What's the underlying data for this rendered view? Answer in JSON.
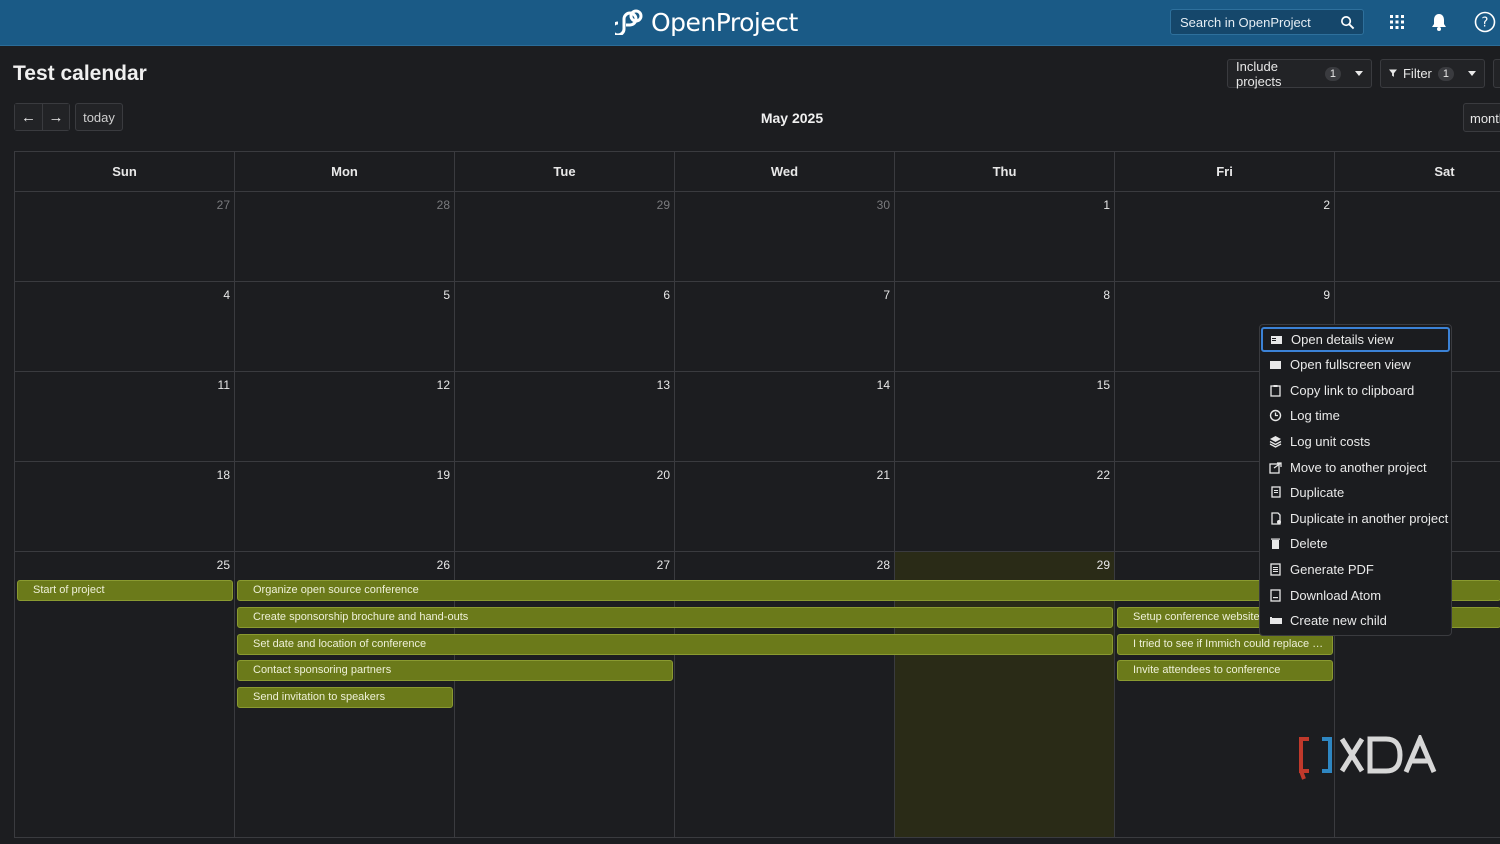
{
  "app": {
    "logo_text": "OpenProject",
    "search_placeholder": "Search in OpenProject"
  },
  "page": {
    "title": "Test calendar",
    "include_projects_label": "Include projects",
    "include_projects_count": "1",
    "filter_label": "Filter",
    "filter_count": "1"
  },
  "nav": {
    "prev_symbol": "←",
    "next_symbol": "→",
    "today_label": "today",
    "month_title": "May 2025",
    "view_label": "month"
  },
  "weekdays": [
    "Sun",
    "Mon",
    "Tue",
    "Wed",
    "Thu",
    "Fri",
    "Sat"
  ],
  "weeks": [
    [
      {
        "n": "27",
        "other": true
      },
      {
        "n": "28",
        "other": true
      },
      {
        "n": "29",
        "other": true
      },
      {
        "n": "30",
        "other": true
      },
      {
        "n": "1"
      },
      {
        "n": "2"
      },
      {
        "n": ""
      }
    ],
    [
      {
        "n": "4"
      },
      {
        "n": "5"
      },
      {
        "n": "6"
      },
      {
        "n": "7"
      },
      {
        "n": "8"
      },
      {
        "n": "9"
      },
      {
        "n": ""
      }
    ],
    [
      {
        "n": "11"
      },
      {
        "n": "12"
      },
      {
        "n": "13"
      },
      {
        "n": "14"
      },
      {
        "n": "15"
      },
      {
        "n": ""
      },
      {
        "n": ""
      }
    ],
    [
      {
        "n": "18"
      },
      {
        "n": "19"
      },
      {
        "n": "20"
      },
      {
        "n": "21"
      },
      {
        "n": "22"
      },
      {
        "n": ""
      },
      {
        "n": ""
      }
    ],
    [
      {
        "n": "25"
      },
      {
        "n": "26"
      },
      {
        "n": "27"
      },
      {
        "n": "28"
      },
      {
        "n": "29",
        "today": true
      },
      {
        "n": ""
      },
      {
        "n": ""
      }
    ]
  ],
  "events": [
    {
      "label": "Start of project",
      "start": 0,
      "end": 0,
      "row": 0
    },
    {
      "label": "Organize open source conference",
      "start": 1,
      "end": 7,
      "row": 0
    },
    {
      "label": "Create sponsorship brochure and hand-outs",
      "start": 1,
      "end": 4,
      "row": 1
    },
    {
      "label": "Setup conference website",
      "start": 5,
      "end": 7,
      "row": 1
    },
    {
      "label": "Set date and location of conference",
      "start": 1,
      "end": 4,
      "row": 2
    },
    {
      "label": "I tried to see if Immich could replace my Google Photos",
      "start": 5,
      "end": 5,
      "row": 2
    },
    {
      "label": "Contact sponsoring partners",
      "start": 1,
      "end": 2,
      "row": 3
    },
    {
      "label": "Invite attendees to conference",
      "start": 5,
      "end": 5,
      "row": 3
    },
    {
      "label": "Send invitation to speakers",
      "start": 1,
      "end": 1,
      "row": 4
    }
  ],
  "context_menu": [
    {
      "label": "Open details view",
      "icon": "details-view-icon"
    },
    {
      "label": "Open fullscreen view",
      "icon": "fullscreen-icon"
    },
    {
      "label": "Copy link to clipboard",
      "icon": "clipboard-icon"
    },
    {
      "label": "Log time",
      "icon": "clock-icon"
    },
    {
      "label": "Log unit costs",
      "icon": "stack-icon"
    },
    {
      "label": "Move to another project",
      "icon": "move-icon"
    },
    {
      "label": "Duplicate",
      "icon": "duplicate-icon"
    },
    {
      "label": "Duplicate in another project",
      "icon": "duplicate-project-icon"
    },
    {
      "label": "Delete",
      "icon": "trash-icon"
    },
    {
      "label": "Generate PDF",
      "icon": "pdf-icon"
    },
    {
      "label": "Download Atom",
      "icon": "atom-icon"
    },
    {
      "label": "Create new child",
      "icon": "child-icon"
    }
  ],
  "watermark": "XDA",
  "colors": {
    "header": "#1a5a86",
    "event": "#6b7a1a",
    "today": "#2a2b17",
    "focus": "#3b82d6"
  }
}
